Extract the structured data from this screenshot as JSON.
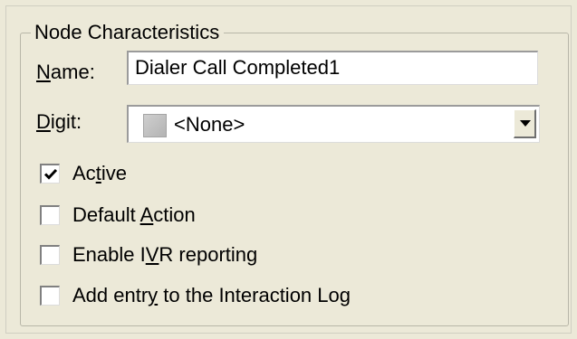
{
  "group": {
    "title": "Node Characteristics"
  },
  "name_field": {
    "label_prefix": "",
    "label_mnemonic": "N",
    "label_rest": "ame:",
    "value": "Dialer Call Completed1"
  },
  "digit_field": {
    "label_prefix": "",
    "label_mnemonic": "D",
    "label_rest": "igit:",
    "selected": "<None>",
    "icon": "digit-swatch-icon"
  },
  "checkboxes": [
    {
      "label_prefix": "Ac",
      "label_mnemonic": "t",
      "label_rest": "ive",
      "checked": true
    },
    {
      "label_prefix": "Default ",
      "label_mnemonic": "A",
      "label_rest": "ction",
      "checked": false
    },
    {
      "label_prefix": "Enable I",
      "label_mnemonic": "V",
      "label_rest": "R reporting",
      "checked": false
    },
    {
      "label_prefix": "Add entr",
      "label_mnemonic": "y",
      "label_rest": " to the Interaction Log",
      "checked": false
    }
  ],
  "colors": {
    "background": "#ece9d8",
    "field_background": "#ffffff"
  }
}
